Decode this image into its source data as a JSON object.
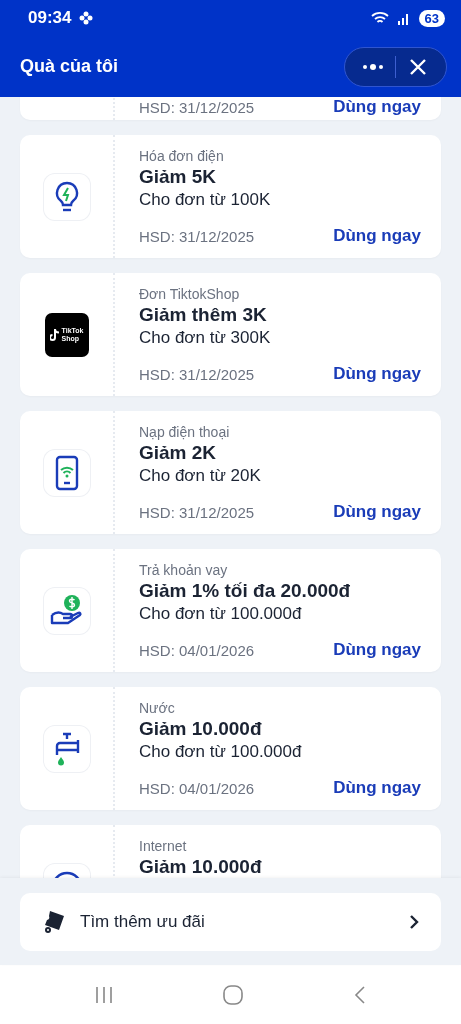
{
  "status_bar": {
    "time": "09:34",
    "battery": "63"
  },
  "header": {
    "title": "Quà của tôi"
  },
  "vouchers": [
    {
      "expiry": "HSD: 31/12/2025",
      "action": "Dùng ngay"
    },
    {
      "kind": "bulb",
      "category": "Hóa đơn điện",
      "title": "Giảm 5K",
      "condition": "Cho đơn từ 100K",
      "expiry": "HSD: 31/12/2025",
      "action": "Dùng ngay"
    },
    {
      "kind": "tiktok",
      "logo_lines": [
        "TikTok",
        "Shop"
      ],
      "category": "Đơn TiktokShop",
      "title": "Giảm thêm 3K",
      "condition": "Cho đơn từ 300K",
      "expiry": "HSD: 31/12/2025",
      "action": "Dùng ngay"
    },
    {
      "kind": "phone",
      "category": "Nạp điện thoại",
      "title": "Giảm 2K",
      "condition": "Cho đơn từ 20K",
      "expiry": "HSD: 31/12/2025",
      "action": "Dùng ngay"
    },
    {
      "kind": "loan",
      "category": "Trả khoản vay",
      "title": "Giảm 1% tối đa 20.000đ",
      "condition": "Cho đơn từ 100.000đ",
      "expiry": "HSD: 04/01/2026",
      "action": "Dùng ngay"
    },
    {
      "kind": "water",
      "category": "Nước",
      "title": "Giảm 10.000đ",
      "condition": "Cho đơn từ 100.000đ",
      "expiry": "HSD: 04/01/2026",
      "action": "Dùng ngay"
    },
    {
      "kind": "internet",
      "category": "Internet",
      "title": "Giảm 10.000đ"
    }
  ],
  "more_offers": {
    "label": "Tìm thêm ưu đãi"
  }
}
